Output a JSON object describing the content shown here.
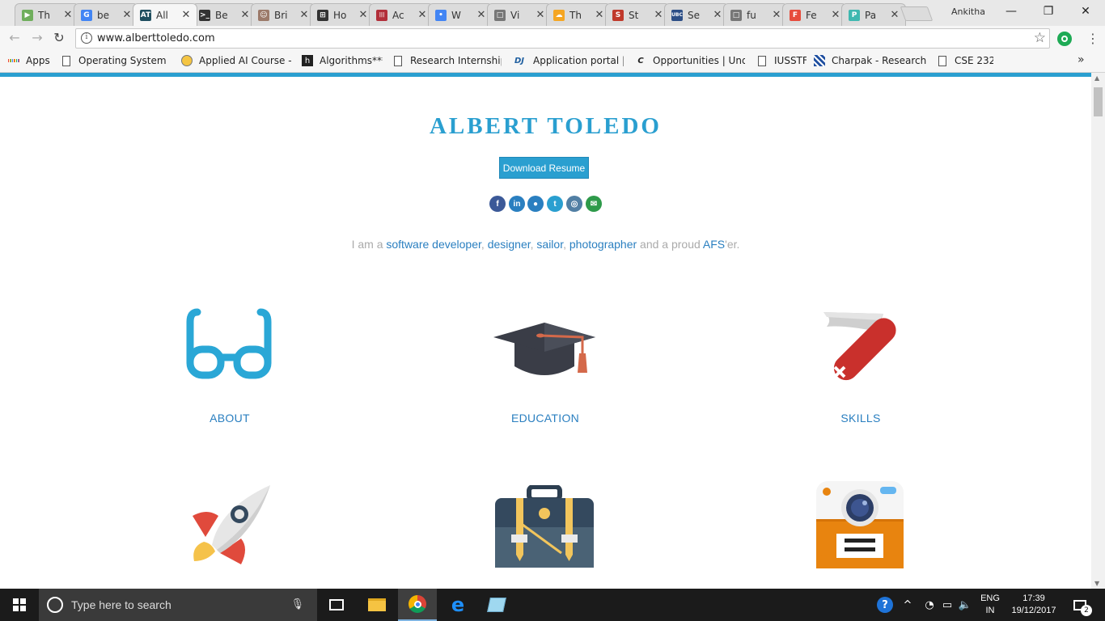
{
  "browser": {
    "tabs": [
      {
        "title": "Th",
        "color": "#6fae5c",
        "glyph": "▶"
      },
      {
        "title": "be",
        "color": "#4285f4",
        "glyph": "G"
      },
      {
        "title": "All",
        "color": "#1f4e5f",
        "glyph": "AT"
      },
      {
        "title": "Be",
        "color": "#333333",
        "glyph": ">_"
      },
      {
        "title": "Bri",
        "color": "#9c7a6a",
        "glyph": "☺"
      },
      {
        "title": "Ho",
        "color": "#333333",
        "glyph": "⊞"
      },
      {
        "title": "Ac",
        "color": "#b22f3a",
        "glyph": "|||"
      },
      {
        "title": "W",
        "color": "#4285f4",
        "glyph": "•"
      },
      {
        "title": "Vi",
        "color": "#777777",
        "glyph": "□"
      },
      {
        "title": "Th",
        "color": "#f5a623",
        "glyph": "☁"
      },
      {
        "title": "St",
        "color": "#c0392b",
        "glyph": "S"
      },
      {
        "title": "Se",
        "color": "#2c4e86",
        "glyph": "UBC"
      },
      {
        "title": "fu",
        "color": "#777777",
        "glyph": "□"
      },
      {
        "title": "Fe",
        "color": "#e74c3c",
        "glyph": "F"
      },
      {
        "title": "Pa",
        "color": "#3fb8b0",
        "glyph": "P"
      }
    ],
    "profile_name": "Ankitha",
    "url": "www.alberttoledo.com",
    "bookmarks": [
      {
        "label": "Apps",
        "icon": "apps-grid-icon"
      },
      {
        "label": "Operating System Co",
        "icon": "page-icon"
      },
      {
        "label": "Applied AI Course - I",
        "icon": "appliedai-icon"
      },
      {
        "label": "Algorithms***",
        "icon": "h-icon"
      },
      {
        "label": "Research Internships",
        "icon": "page-icon"
      },
      {
        "label": "Application portal | R",
        "icon": "dj-icon"
      },
      {
        "label": "Opportunities | Unde",
        "icon": "cal-icon"
      },
      {
        "label": "IUSSTF",
        "icon": "page-icon"
      },
      {
        "label": "Charpak - Research Ir",
        "icon": "charpak-icon"
      },
      {
        "label": "CSE 232",
        "icon": "page-icon"
      }
    ]
  },
  "site": {
    "name": "ALBERT TOLEDO",
    "resume_button": "Download Resume",
    "social": [
      {
        "name": "facebook",
        "glyph": "f",
        "color": "#3b5998"
      },
      {
        "name": "linkedin",
        "glyph": "in",
        "color": "#2a7fc0"
      },
      {
        "name": "github",
        "glyph": "●",
        "color": "#2a7fc0"
      },
      {
        "name": "twitter",
        "glyph": "t",
        "color": "#2a9fd0"
      },
      {
        "name": "instagram",
        "glyph": "◎",
        "color": "#517fa4"
      },
      {
        "name": "email",
        "glyph": "✉",
        "color": "#2e9a4a"
      }
    ],
    "tagline": {
      "prefix": "I am a ",
      "role1": "software developer",
      "sep1": ", ",
      "role2": "designer",
      "sep2": ", ",
      "role3": "sailor",
      "sep3": ", ",
      "role4": "photographer",
      "middle": " and a proud ",
      "org": "AFS",
      "suffix": "'er."
    },
    "sections": [
      {
        "label": "ABOUT",
        "icon": "glasses-icon"
      },
      {
        "label": "EDUCATION",
        "icon": "graduation-cap-icon"
      },
      {
        "label": "SKILLS",
        "icon": "swiss-knife-icon"
      },
      {
        "label": "",
        "icon": "rocket-icon"
      },
      {
        "label": "",
        "icon": "briefcase-icon"
      },
      {
        "label": "",
        "icon": "camera-icon"
      }
    ]
  },
  "taskbar": {
    "search_placeholder": "Type here to search",
    "language_top": "ENG",
    "language_bottom": "IN",
    "time": "17:39",
    "date": "19/12/2017",
    "notifications_count": "2"
  }
}
